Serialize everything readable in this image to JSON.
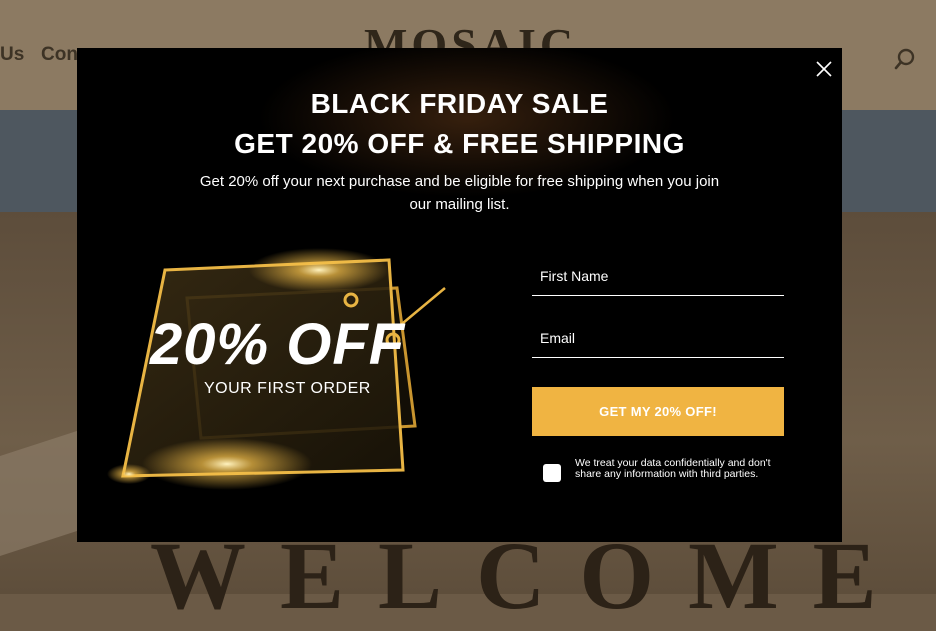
{
  "site": {
    "nav_partial_left": "Us",
    "nav_partial_second": "Con",
    "logo_partial": "MOSAIC",
    "hero_title_partial": "WELCOME",
    "search_icon": "search-icon"
  },
  "popup": {
    "headline_line1": "BLACK FRIDAY SALE",
    "headline_line2": "GET 20% OFF & FREE SHIPPING",
    "subtext": "Get 20% off your next purchase and be eligible for free shipping when you join our mailing list.",
    "promo_big": "20% OFF",
    "promo_small": "YOUR FIRST ORDER",
    "first_name_placeholder": "First Name",
    "email_placeholder": "Email",
    "cta_label": "GET MY 20% OFF!",
    "consent_text": "We treat your data confidentially and don't share any information with third parties.",
    "close_icon": "close-icon",
    "colors": {
      "accent": "#f0b442",
      "background": "#000000",
      "glow": "#f5c04a"
    }
  }
}
